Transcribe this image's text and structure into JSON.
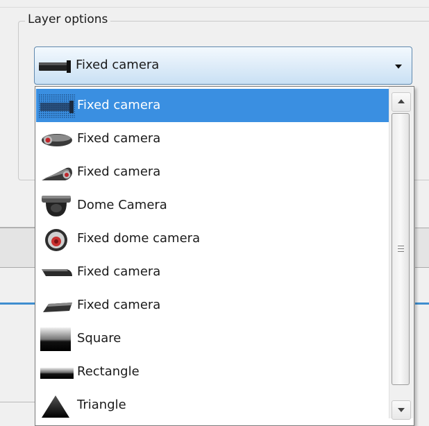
{
  "layer_options": {
    "legend": "Layer options",
    "combo": {
      "selected_value": "Fixed camera",
      "selected_icon": "bullet-camera-icon"
    },
    "dropdown": {
      "items": [
        {
          "label": "Fixed camera",
          "icon": "bullet-camera-icon",
          "selected": true
        },
        {
          "label": "Fixed camera",
          "icon": "round-camera-icon",
          "selected": false
        },
        {
          "label": "Fixed camera",
          "icon": "angled-camera-icon",
          "selected": false
        },
        {
          "label": "Dome Camera",
          "icon": "dome-camera-icon",
          "selected": false
        },
        {
          "label": "Fixed dome camera",
          "icon": "fixed-dome-camera-icon",
          "selected": false
        },
        {
          "label": "Fixed camera",
          "icon": "flat-camera-icon",
          "selected": false
        },
        {
          "label": "Fixed camera",
          "icon": "slim-camera-icon",
          "selected": false
        },
        {
          "label": "Square",
          "icon": "square-shape-icon",
          "selected": false
        },
        {
          "label": "Rectangle",
          "icon": "rectangle-shape-icon",
          "selected": false
        },
        {
          "label": "Triangle",
          "icon": "triangle-shape-icon",
          "selected": false
        }
      ],
      "scroll_position_fraction": 0.0
    }
  },
  "colors": {
    "selection": "#3a8fe1",
    "combo_border": "#5f88ad"
  }
}
